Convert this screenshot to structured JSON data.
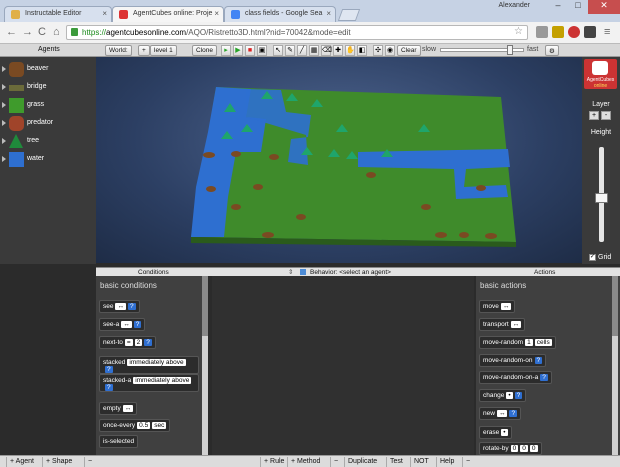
{
  "browser": {
    "tabs": [
      {
        "title": "Instructable Editor",
        "color": "#e0b04a"
      },
      {
        "title": "AgentCubes online: Proje",
        "color": "#d33"
      },
      {
        "title": "class fields - Google Sea",
        "color": "#4285f4"
      }
    ],
    "user": "Alexander",
    "url_prefix": "https://",
    "url_host": "agentcubesonline.com",
    "url_path": "/AQO/Ristretto3D.html?nid=70042&mode=edit",
    "nav": {
      "back": "←",
      "forward": "→",
      "reload": "C",
      "home": "⌂",
      "star": "☆",
      "menu": "≡"
    }
  },
  "toolbar": {
    "agents_header": "Agents",
    "world_select": "World:",
    "plus": "+",
    "level_select": "level 1",
    "clone": "Clone",
    "clear": "Clear",
    "slow": "slow",
    "fast": "fast",
    "gear": "⚙"
  },
  "agents": [
    {
      "name": "beaver",
      "color": "#7a4a22"
    },
    {
      "name": "bridge",
      "color": "#6b6b3a"
    },
    {
      "name": "grass",
      "color": "#3f9b2c"
    },
    {
      "name": "predator",
      "color": "#a0442a"
    },
    {
      "name": "tree",
      "color": "#1f8a3b"
    },
    {
      "name": "water",
      "color": "#2e6fd0"
    }
  ],
  "right_panel": {
    "logo_line1": "AgentCubes",
    "logo_line2": "online",
    "layer": "Layer",
    "layer_plus": "+",
    "layer_minus": "-",
    "height": "Height",
    "grid": "Grid"
  },
  "headers": {
    "conditions": "Conditions",
    "behavior": "Behavior: <select an agent>",
    "actions": "Actions"
  },
  "conditions": {
    "title": "basic conditions",
    "items": [
      {
        "label": "see",
        "chips": [
          "↔",
          "?"
        ]
      },
      {
        "label": "see-a",
        "chips": [
          "↔",
          "?"
        ]
      },
      {
        "label": "next-to",
        "chips": [
          "=",
          "2",
          "?"
        ]
      },
      {
        "label": "stacked",
        "chips": [
          "immediately above",
          "?"
        ]
      },
      {
        "label": "stacked-a",
        "chips": [
          "immediately above",
          "?"
        ]
      },
      {
        "label": "empty",
        "chips": [
          "↔"
        ]
      },
      {
        "label": "once-every",
        "chips": [
          "0.5",
          "sec"
        ]
      },
      {
        "label": "is-selected",
        "chips": []
      }
    ]
  },
  "actions": {
    "title": "basic actions",
    "items": [
      {
        "label": "move",
        "chips": [
          "↔"
        ]
      },
      {
        "label": "transport",
        "chips": [
          "↔"
        ]
      },
      {
        "label": "move-random",
        "chips": [
          "1",
          "cells"
        ]
      },
      {
        "label": "move-random-on",
        "chips": [
          "?"
        ]
      },
      {
        "label": "move-random-on-a",
        "chips": [
          "?"
        ]
      },
      {
        "label": "change",
        "chips": [
          "•",
          "?"
        ]
      },
      {
        "label": "new",
        "chips": [
          "↔",
          "?"
        ]
      },
      {
        "label": "erase",
        "chips": [
          "•"
        ]
      },
      {
        "label": "rotate-by",
        "chips": [
          "0",
          "0",
          "0"
        ]
      }
    ]
  },
  "bottom": {
    "items": [
      "+ Agent",
      "+ Shape",
      "−",
      "+ Rule",
      "+ Method",
      "−",
      "Duplicate",
      "Test",
      "NOT",
      "Help",
      "−"
    ]
  }
}
